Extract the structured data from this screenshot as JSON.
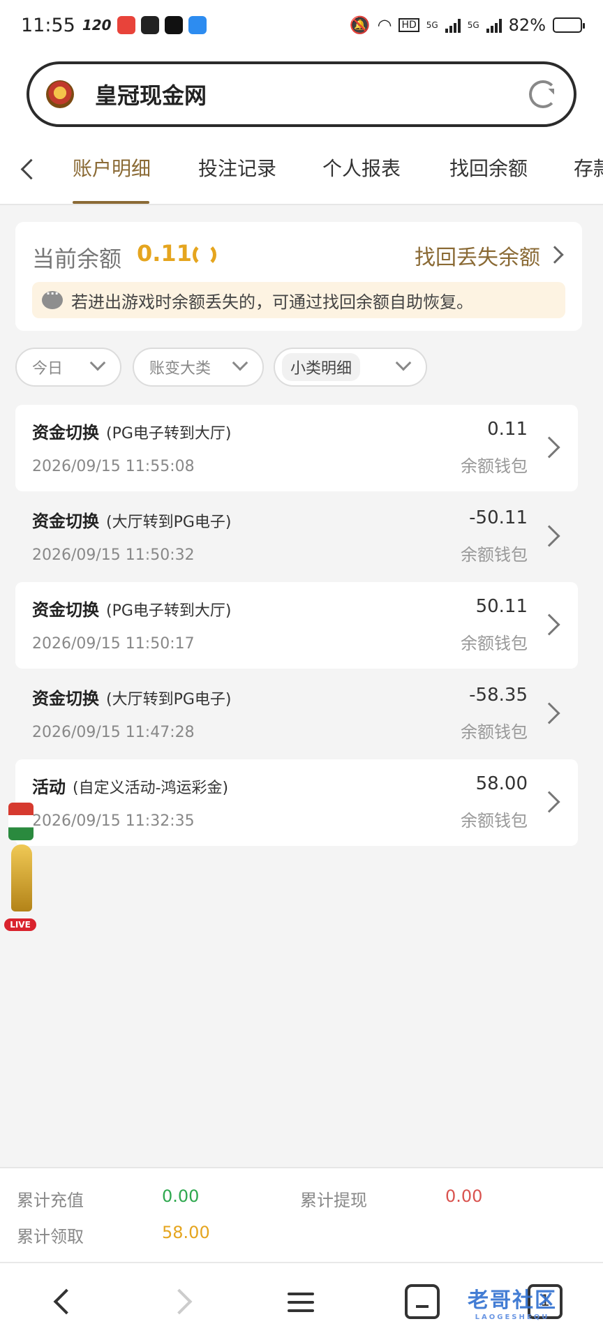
{
  "status_bar": {
    "time": "11:55",
    "refresh_rate": "120",
    "battery": "82%",
    "battery_level": 0.82,
    "network_labels": [
      "5G",
      "5G"
    ]
  },
  "address_bar": {
    "site_name": "皇冠现金网"
  },
  "tabs": [
    {
      "label": "账户明细",
      "active": true
    },
    {
      "label": "投注记录",
      "active": false
    },
    {
      "label": "个人报表",
      "active": false
    },
    {
      "label": "找回余额",
      "active": false
    },
    {
      "label": "存款",
      "active": false
    }
  ],
  "balance_card": {
    "label": "当前余额",
    "value": "0.11",
    "recover_link": "找回丢失余额",
    "notice": "若进出游戏时余额丢失的，可通过找回余额自助恢复。"
  },
  "filters": [
    {
      "label": "今日"
    },
    {
      "label": "账变大类"
    },
    {
      "label": "小类明细"
    }
  ],
  "records": [
    {
      "title": "资金切换",
      "detail": "(PG电子转到大厅)",
      "date": "2026/09/15 11:55:08",
      "amount": "0.11",
      "wallet": "余额钱包"
    },
    {
      "title": "资金切换",
      "detail": "(大厅转到PG电子)",
      "date": "2026/09/15 11:50:32",
      "amount": "-50.11",
      "wallet": "余额钱包"
    },
    {
      "title": "资金切换",
      "detail": "(PG电子转到大厅)",
      "date": "2026/09/15 11:50:17",
      "amount": "50.11",
      "wallet": "余额钱包"
    },
    {
      "title": "资金切换",
      "detail": "(大厅转到PG电子)",
      "date": "2026/09/15 11:47:28",
      "amount": "-58.35",
      "wallet": "余额钱包"
    },
    {
      "title": "活动",
      "detail": "(自定义活动-鸿运彩金)",
      "date": "2026/09/15 11:32:35",
      "amount": "58.00",
      "wallet": "余额钱包"
    }
  ],
  "float_widget": {
    "live_label": "LIVE"
  },
  "summary": {
    "deposit_label": "累计充值",
    "deposit_value": "0.00",
    "withdraw_label": "累计提现",
    "withdraw_value": "0.00",
    "claim_label": "累计领取",
    "claim_value": "58.00"
  },
  "bottom_nav": {
    "tab_count": "1",
    "watermark": "老哥社区",
    "watermark_sub": "LAOGESHEQU"
  },
  "colors": {
    "accent_gold": "#e5a51f",
    "brand_brown": "#8a6a35",
    "positive_green": "#2fa84f",
    "negative_red": "#d9534f"
  }
}
